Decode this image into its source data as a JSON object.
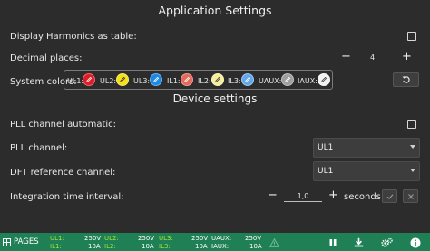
{
  "app_settings": {
    "title": "Application Settings",
    "display_harmonics_label": "Display Harmonics as table:",
    "display_harmonics_checked": false,
    "decimal_places_label": "Decimal places:",
    "decimal_places_value": "4",
    "decimal_minus": "−",
    "decimal_plus": "+",
    "system_colors_label": "System colors:",
    "colors": [
      {
        "label": "UL1:",
        "color": "#e01b24"
      },
      {
        "label": "UL2:",
        "color": "#f5e11a"
      },
      {
        "label": "UL3:",
        "color": "#1e88e5"
      },
      {
        "label": "IL1:",
        "color": "#e46a5a"
      },
      {
        "label": "IL2:",
        "color": "#f7ee9c"
      },
      {
        "label": "IL3:",
        "color": "#64a8ea"
      },
      {
        "label": "UAUX:",
        "color": "#9e9e9e"
      },
      {
        "label": "IAUX:",
        "color": "#f2f2f2"
      }
    ],
    "reset_icon": "reset-icon"
  },
  "device_settings": {
    "title": "Device settings",
    "pll_auto_label": "PLL channel automatic:",
    "pll_auto_checked": false,
    "pll_channel_label": "PLL channel:",
    "pll_channel_value": "UL1",
    "dft_label": "DFT reference channel:",
    "dft_value": "UL1",
    "integration_label": "Integration time interval:",
    "integration_value": "1,0",
    "integration_minus": "−",
    "integration_plus": "+",
    "integration_unit": "seconds"
  },
  "footer": {
    "pages_label": "PAGES",
    "readings": [
      {
        "k1": "UL1:",
        "k2": "IL1:",
        "v1": "250V",
        "v2": "10A"
      },
      {
        "k1": "UL2:",
        "k2": "IL2:",
        "v1": "250V",
        "v2": "10A"
      },
      {
        "k1": "UL3:",
        "k2": "IL3:",
        "v1": "250V",
        "v2": "10A"
      },
      {
        "k1": "UAUX:",
        "k2": "IAUX:",
        "v1": "250V",
        "v2": "10A"
      }
    ],
    "background_color": "#1f7f55"
  }
}
